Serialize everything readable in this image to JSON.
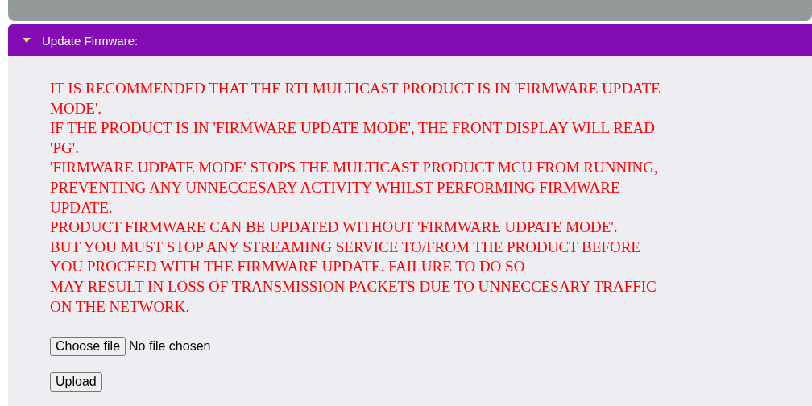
{
  "sections": [
    {
      "expanded": false
    },
    {
      "title": "Update Firmware:",
      "expanded": true
    }
  ],
  "warning_lines": [
    "IT IS RECOMMENDED THAT THE RTI MULTICAST PRODUCT IS IN 'FIRMWARE UPDATE",
    "MODE'.",
    "IF THE PRODUCT IS IN 'FIRMWARE UPDATE MODE', THE FRONT DISPLAY WILL READ",
    "'PG'.",
    "'FIRMWARE UDPATE MODE' STOPS THE MULTICAST PRODUCT MCU FROM RUNNING,",
    "PREVENTING ANY UNNECCESARY ACTIVITY WHILST PERFORMING FIRMWARE",
    "UPDATE.",
    "PRODUCT FIRMWARE CAN BE UPDATED WITHOUT 'FIRMWARE UDPATE MODE'.",
    "BUT YOU MUST STOP ANY STREAMING SERVICE TO/FROM THE PRODUCT BEFORE",
    "YOU PROCEED WITH THE FIRMWARE UPDATE. FAILURE TO DO SO",
    "MAY RESULT IN LOSS OF TRANSMISSION PACKETS DUE TO UNNECCESARY TRAFFIC",
    "ON THE NETWORK."
  ],
  "file_input": {
    "button": "Choose file",
    "status": "No file chosen"
  },
  "upload_button": "Upload"
}
